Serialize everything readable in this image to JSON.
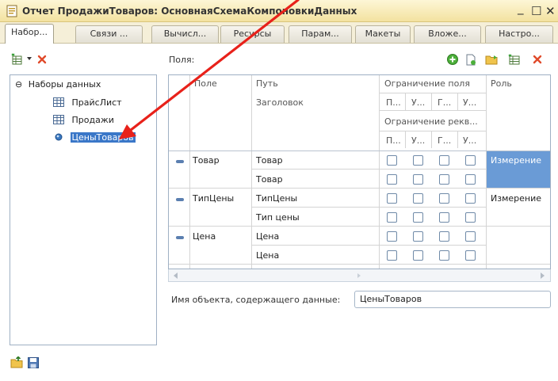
{
  "window": {
    "title": "Отчет ПродажиТоваров: ОсновнаяСхемаКомпоновкиДанных",
    "min_glyph": "_",
    "max_glyph": "☐",
    "close_glyph": "✕"
  },
  "tabs": [
    {
      "label": "Набор...",
      "active": true
    },
    {
      "label": "Связи ...",
      "active": false
    },
    {
      "label": "Вычисл...",
      "active": false
    },
    {
      "label": "Ресурсы",
      "active": false
    },
    {
      "label": "Парам...",
      "active": false
    },
    {
      "label": "Макеты",
      "active": false
    },
    {
      "label": "Вложе...",
      "active": false
    },
    {
      "label": "Настро...",
      "active": false
    }
  ],
  "left_toolbar": {
    "icons": [
      "add-dataset-icon",
      "dropdown-arrow-icon",
      "delete-icon"
    ]
  },
  "tree": {
    "root": {
      "label": "Наборы данных",
      "toggle": "⊖"
    },
    "items": [
      {
        "label": "ПрайсЛист",
        "icon": "table-icon",
        "selected": false
      },
      {
        "label": "Продажи",
        "icon": "table-icon",
        "selected": false
      },
      {
        "label": "ЦеныТоваров",
        "icon": "dot-icon",
        "selected": true
      }
    ]
  },
  "fields": {
    "label": "Поля:",
    "toolbar_icons": [
      "add-field-icon",
      "add-folder-icon",
      "folder-icon",
      "table-add-icon",
      "delete-icon"
    ],
    "headers": {
      "field": "Поле",
      "path": "Путь",
      "title": "Заголовок",
      "field_restriction": "Ограничение поля",
      "attr_restriction": "Ограничение рекв...",
      "role": "Роль",
      "sub": [
        "П...",
        "У...",
        "Г...",
        "У..."
      ]
    },
    "rows": [
      {
        "field": "Товар",
        "path": "Товар",
        "title": "Товар",
        "role": "Измерение",
        "selected": true
      },
      {
        "field": "ТипЦены",
        "path": "ТипЦены",
        "title": "Тип цены",
        "role": "Измерение",
        "selected": false
      },
      {
        "field": "Цена",
        "path": "Цена",
        "title": "Цена",
        "role": "",
        "selected": false
      }
    ]
  },
  "object_name": {
    "label": "Имя объекта, содержащего данные:",
    "value": "ЦеныТоваров"
  },
  "bottom_icons": [
    "export-icon",
    "save-icon"
  ],
  "colors": {
    "title_bg": "#f3e2a0",
    "selection": "#3a77c8",
    "role_selection": "#6a9bd6",
    "arrow": "#e8211a"
  }
}
